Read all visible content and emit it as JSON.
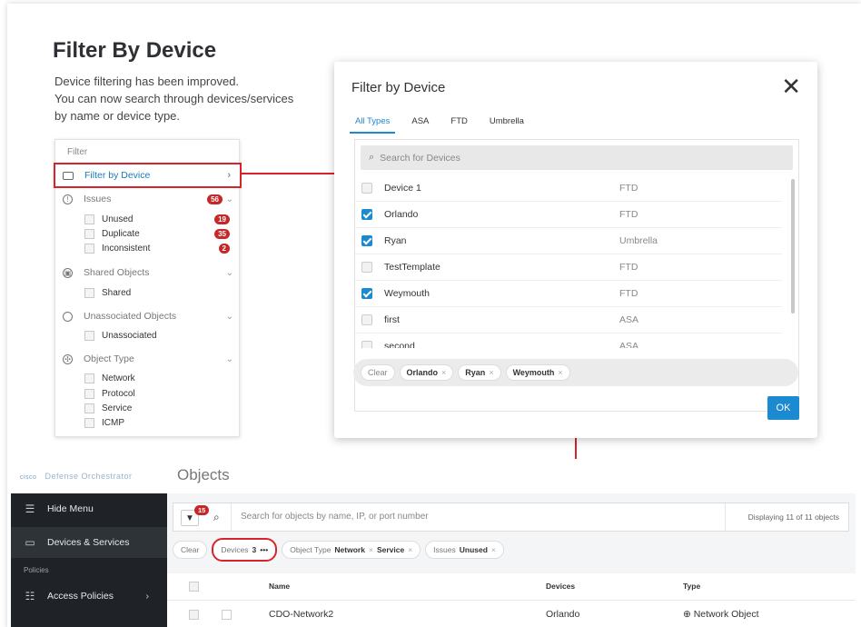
{
  "slide": {
    "title": "Filter By Device",
    "subtitle_lines": [
      "Device filtering has been improved.",
      "You can now search through devices/services",
      "by name or device type."
    ]
  },
  "filter_panel": {
    "heading": "Filter",
    "filter_by_device": "Filter by Device",
    "sections": {
      "issues": {
        "label": "Issues",
        "count": "56"
      },
      "shared_objects": {
        "label": "Shared Objects"
      },
      "unassociated_objects": {
        "label": "Unassociated Objects"
      },
      "object_type": {
        "label": "Object Type"
      }
    },
    "issue_items": [
      {
        "label": "Unused",
        "count": "19"
      },
      {
        "label": "Duplicate",
        "count": "35"
      },
      {
        "label": "Inconsistent",
        "count": "2"
      }
    ],
    "shared_items": [
      "Shared"
    ],
    "unassociated_items": [
      "Unassociated"
    ],
    "object_type_items": [
      "Network",
      "Protocol",
      "Service",
      "ICMP"
    ]
  },
  "modal": {
    "title": "Filter by Device",
    "close_glyph": "✕",
    "tabs": [
      "All Types",
      "ASA",
      "FTD",
      "Umbrella"
    ],
    "active_tab": "All Types",
    "search_placeholder": "Search for Devices",
    "devices": [
      {
        "name": "Device 1",
        "type": "FTD",
        "checked": false
      },
      {
        "name": "Orlando",
        "type": "FTD",
        "checked": true
      },
      {
        "name": "Ryan",
        "type": "Umbrella",
        "checked": true
      },
      {
        "name": "TestTemplate",
        "type": "FTD",
        "checked": false
      },
      {
        "name": "Weymouth",
        "type": "FTD",
        "checked": true
      },
      {
        "name": "first",
        "type": "ASA",
        "checked": false
      },
      {
        "name": "second",
        "type": "ASA",
        "checked": false
      }
    ],
    "clear_label": "Clear",
    "selected_chips": [
      "Orlando",
      "Ryan",
      "Weymouth"
    ],
    "ok_label": "OK"
  },
  "app": {
    "brand_logo": "cisco",
    "brand_name": "Defense Orchestrator",
    "heading": "Objects",
    "sidebar": {
      "hide_menu": "Hide Menu",
      "devices_services": "Devices & Services",
      "policies_heading": "Policies",
      "access_policies": "Access Policies"
    },
    "filter_badge": "15",
    "search_placeholder": "Search for objects by name, IP, or port number",
    "displaying": "Displaying 11 of 11 objects",
    "filter_chips": {
      "clear": "Clear",
      "devices_label": "Devices",
      "devices_count": "3",
      "devices_more": "•••",
      "object_type_label": "Object Type",
      "object_type_values": [
        "Network",
        "Service"
      ],
      "issues_label": "Issues",
      "issues_value": "Unused"
    },
    "table": {
      "columns": [
        "Name",
        "Devices",
        "Type"
      ],
      "rows": [
        {
          "name": "CDO-Network2",
          "devices": "Orlando",
          "type": "Network Object"
        }
      ]
    }
  }
}
